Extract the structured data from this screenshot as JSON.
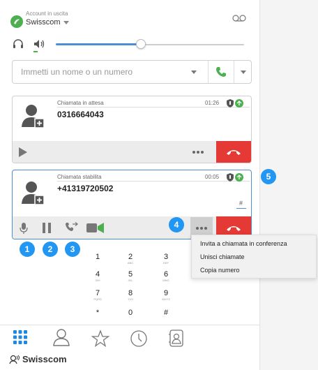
{
  "account": {
    "label": "Account in uscita",
    "name": "Swisscom"
  },
  "search": {
    "placeholder": "Immetti un nome o un numero"
  },
  "volume": {
    "level": 0.45
  },
  "calls": [
    {
      "status": "Chiamata in attesa",
      "number": "0316664043",
      "timer": "01:26"
    },
    {
      "status": "Chiamata stabilita",
      "number": "+41319720502",
      "timer": "00:05",
      "dialpad_symbol": "#"
    }
  ],
  "badges": [
    "1",
    "2",
    "3",
    "4",
    "5"
  ],
  "context_menu": {
    "items": [
      "Invita a chiamata in conferenza",
      "Unisci chiamate",
      "Copia numero"
    ]
  },
  "dialpad": [
    {
      "digit": "1",
      "letters": ""
    },
    {
      "digit": "2",
      "letters": "ABC"
    },
    {
      "digit": "3",
      "letters": "DEF"
    },
    {
      "digit": "4",
      "letters": "GHI"
    },
    {
      "digit": "5",
      "letters": "JKL"
    },
    {
      "digit": "6",
      "letters": "MNO"
    },
    {
      "digit": "7",
      "letters": "PQRS"
    },
    {
      "digit": "8",
      "letters": "TUV"
    },
    {
      "digit": "9",
      "letters": "WXYZ"
    },
    {
      "digit": "*",
      "letters": ""
    },
    {
      "digit": "0",
      "letters": ""
    },
    {
      "digit": "#",
      "letters": ""
    }
  ],
  "brand": {
    "name": "Swisscom"
  },
  "colors": {
    "accent": "#4a8ed8",
    "hangup": "#e53935",
    "call_green": "#4caf50",
    "badge": "#2196f3"
  }
}
